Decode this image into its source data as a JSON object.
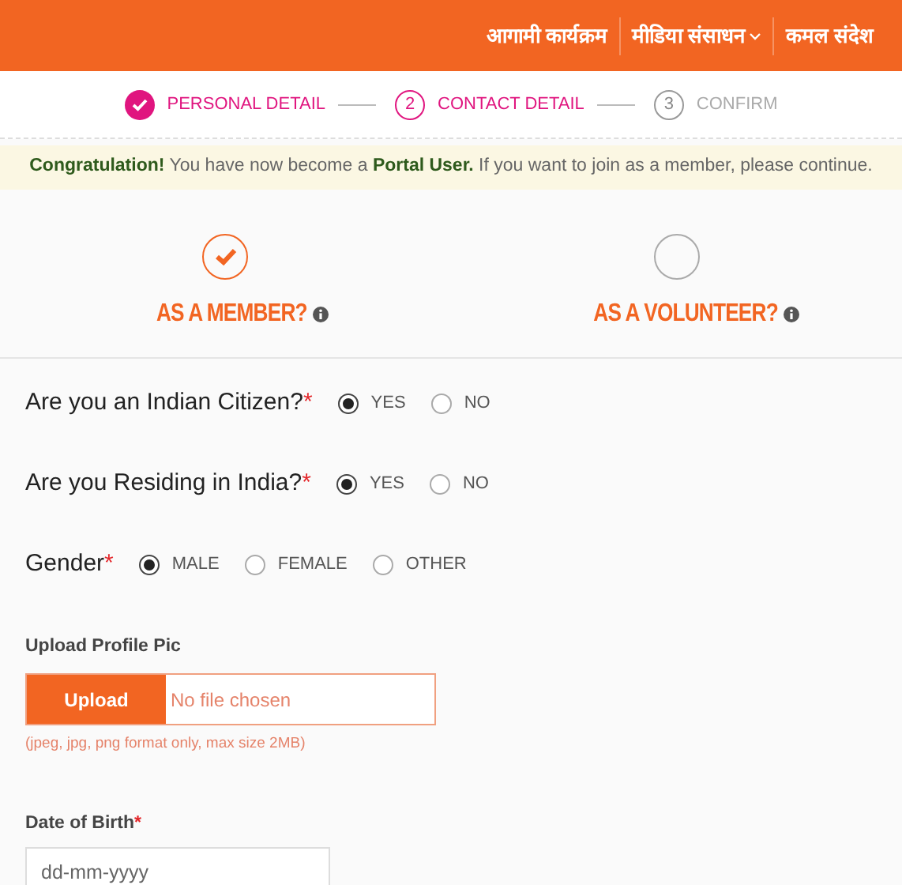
{
  "nav": [
    {
      "label": "आगामी कार्यक्रम",
      "dropdown": false
    },
    {
      "label": "मीडिया संसाधन",
      "dropdown": true
    },
    {
      "label": "कमल संदेश",
      "dropdown": false
    }
  ],
  "steps": [
    {
      "label": "PERSONAL DETAIL",
      "completed": true,
      "selected": false
    },
    {
      "number": "2",
      "label": "CONTACT DETAIL",
      "completed": false,
      "selected": true
    },
    {
      "number": "3",
      "label": "CONFIRM",
      "completed": false,
      "selected": false
    }
  ],
  "notice": "**Congratulation!** You have now become a **Portal User.** If you want to join as a member, please continue.",
  "roles": [
    {
      "label": "AS A MEMBER?",
      "selected": true
    },
    {
      "label": "AS A VOLUNTEER?",
      "selected": false
    }
  ],
  "questions": [
    {
      "label": "Are you an Indian Citizen?",
      "required_mark": "*",
      "options": [
        {
          "label": "YES",
          "selected": true
        },
        {
          "label": "NO",
          "selected": false
        }
      ]
    },
    {
      "label": "Are you Residing in India?",
      "required_mark": "*",
      "options": [
        {
          "label": "YES",
          "selected": true
        },
        {
          "label": "NO",
          "selected": false
        }
      ]
    },
    {
      "label": "Gender",
      "required_mark": "*",
      "options": [
        {
          "label": "MALE",
          "selected": true
        },
        {
          "label": "FEMALE",
          "selected": false
        },
        {
          "label": "OTHER",
          "selected": false
        }
      ]
    }
  ],
  "upload": {
    "label": "Upload Profile Pic",
    "button": "Upload",
    "value": "No file chosen",
    "hint": "(jpeg, jpg, png format only, max size 2MB)"
  },
  "dob": {
    "label": "Date of Birth",
    "required_mark": "*",
    "placeholder": "dd-mm-yyyy"
  }
}
